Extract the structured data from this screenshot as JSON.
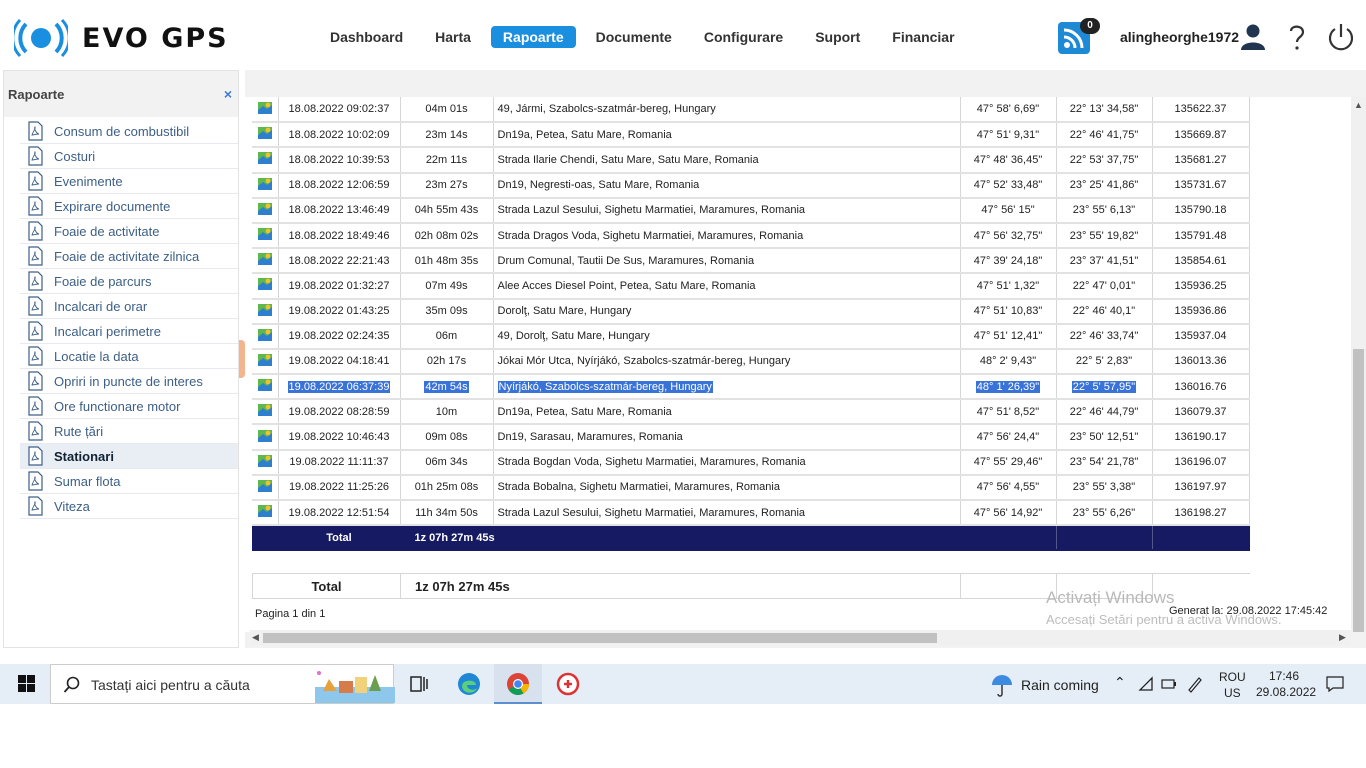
{
  "header": {
    "logo_text": "EVO GPS",
    "nav": [
      {
        "label": "Dashboard",
        "active": false
      },
      {
        "label": "Harta",
        "active": false
      },
      {
        "label": "Rapoarte",
        "active": true
      },
      {
        "label": "Documente",
        "active": false
      },
      {
        "label": "Configurare",
        "active": false
      },
      {
        "label": "Suport",
        "active": false
      },
      {
        "label": "Financiar",
        "active": false
      }
    ],
    "notification_count": "0",
    "username": "alingheorghe1972",
    "accent_color": "#1b8fdf"
  },
  "sidebar": {
    "title": "Rapoarte",
    "close_label": "×",
    "items": [
      {
        "label": "Consum de combustibil"
      },
      {
        "label": "Costuri"
      },
      {
        "label": "Evenimente"
      },
      {
        "label": "Expirare documente"
      },
      {
        "label": "Foaie de activitate"
      },
      {
        "label": "Foaie de activitate zilnica"
      },
      {
        "label": "Foaie de parcurs"
      },
      {
        "label": "Incalcari de orar"
      },
      {
        "label": "Incalcari perimetre"
      },
      {
        "label": "Locatie la data"
      },
      {
        "label": "Opriri in puncte de interes"
      },
      {
        "label": "Ore functionare motor"
      },
      {
        "label": "Rute țări"
      },
      {
        "label": "Stationari",
        "active": true
      },
      {
        "label": "Sumar flota"
      },
      {
        "label": "Viteza"
      }
    ]
  },
  "report": {
    "rows": [
      {
        "date": "18.08.2022 09:02:37",
        "duration": "04m 01s",
        "address": "49,   Jármi, Szabolcs-szatmár-bereg, Hungary",
        "lat": "47° 58' 6,69\"",
        "lon": "22° 13' 34,58\"",
        "km": "135622.37"
      },
      {
        "date": "18.08.2022 10:02:09",
        "duration": "23m 14s",
        "address": "Dn19a,   Petea, Satu Mare, Romania",
        "lat": "47° 51' 9,31\"",
        "lon": "22° 46' 41,75\"",
        "km": "135669.87"
      },
      {
        "date": "18.08.2022 10:39:53",
        "duration": "22m 11s",
        "address": "Strada Ilarie Chendi,   Satu Mare, Satu Mare, Romania",
        "lat": "47° 48' 36,45\"",
        "lon": "22° 53' 37,75\"",
        "km": "135681.27"
      },
      {
        "date": "18.08.2022 12:06:59",
        "duration": "23m 27s",
        "address": "Dn19,   Negresti-oas, Satu Mare, Romania",
        "lat": "47° 52' 33,48\"",
        "lon": "23° 25' 41,86\"",
        "km": "135731.67"
      },
      {
        "date": "18.08.2022 13:46:49",
        "duration": "04h 55m 43s",
        "address": "Strada Lazul Sesului,   Sighetu Marmatiei, Maramures, Romania",
        "lat": "47° 56' 15\"",
        "lon": "23° 55' 6,13\"",
        "km": "135790.18"
      },
      {
        "date": "18.08.2022 18:49:46",
        "duration": "02h 08m 02s",
        "address": "Strada Dragos Voda,   Sighetu Marmatiei, Maramures, Romania",
        "lat": "47° 56' 32,75\"",
        "lon": "23° 55' 19,82\"",
        "km": "135791.48"
      },
      {
        "date": "18.08.2022 22:21:43",
        "duration": "01h 48m 35s",
        "address": "Drum Comunal,   Tautii De Sus, Maramures, Romania",
        "lat": "47° 39' 24,18\"",
        "lon": "23° 37' 41,51\"",
        "km": "135854.61"
      },
      {
        "date": "19.08.2022 01:32:27",
        "duration": "07m 49s",
        "address": "Alee Acces Diesel Point,   Petea, Satu Mare, Romania",
        "lat": "47° 51' 1,32\"",
        "lon": "22° 47' 0,01\"",
        "km": "135936.25"
      },
      {
        "date": "19.08.2022 01:43:25",
        "duration": "35m 09s",
        "address": "Dorolţ, Satu Mare, Hungary",
        "lat": "47° 51' 10,83\"",
        "lon": "22° 46' 40,1\"",
        "km": "135936.86"
      },
      {
        "date": "19.08.2022 02:24:35",
        "duration": "06m",
        "address": "49,   Dorolţ, Satu Mare, Hungary",
        "lat": "47° 51' 12,41\"",
        "lon": "22° 46' 33,74\"",
        "km": "135937.04"
      },
      {
        "date": "19.08.2022 04:18:41",
        "duration": "02h 17s",
        "address": "Jókai Mór Utca,   Nyírjákó, Szabolcs-szatmár-bereg, Hungary",
        "lat": "48° 2' 9,43\"",
        "lon": "22° 5' 2,83\"",
        "km": "136013.36"
      },
      {
        "date": "19.08.2022 06:37:39",
        "duration": "42m 54s",
        "address": "Nyírjákó, Szabolcs-szatmár-bereg, Hungary",
        "lat": "48° 1' 26,39\"",
        "lon": "22° 5' 57,95\"",
        "km": "136016.76",
        "selected": true
      },
      {
        "date": "19.08.2022 08:28:59",
        "duration": "10m",
        "address": "Dn19a,   Petea, Satu Mare, Romania",
        "lat": "47° 51' 8,52\"",
        "lon": "22° 46' 44,79\"",
        "km": "136079.37"
      },
      {
        "date": "19.08.2022 10:46:43",
        "duration": "09m 08s",
        "address": "Dn19,   Sarasau, Maramures, Romania",
        "lat": "47° 56' 24,4\"",
        "lon": "23° 50' 12,51\"",
        "km": "136190.17"
      },
      {
        "date": "19.08.2022 11:11:37",
        "duration": "06m 34s",
        "address": "Strada Bogdan Voda,   Sighetu Marmatiei, Maramures, Romania",
        "lat": "47° 55' 29,46\"",
        "lon": "23° 54' 21,78\"",
        "km": "136196.07"
      },
      {
        "date": "19.08.2022 11:25:26",
        "duration": "01h 25m 08s",
        "address": "Strada Bobalna,   Sighetu Marmatiei, Maramures, Romania",
        "lat": "47° 56' 4,55\"",
        "lon": "23° 55' 3,38\"",
        "km": "136197.97"
      },
      {
        "date": "19.08.2022 12:51:54",
        "duration": "11h 34m 50s",
        "address": "Strada Lazul Sesului,   Sighetu Marmatiei, Maramures, Romania",
        "lat": "47° 56' 14,92\"",
        "lon": "23° 55' 6,26\"",
        "km": "136198.27"
      }
    ],
    "total_label": "Total",
    "total_value": "1z 07h 27m 45s",
    "grand_total_label": "Total",
    "grand_total_value": "1z 07h 27m 45s",
    "pagination": "Pagina 1 din 1",
    "generated": "Generat la: 29.08.2022 17:45:42",
    "header_color": "#151a63",
    "selection_color": "#3a73d8"
  },
  "watermark": {
    "line1": "Activați Windows",
    "line2": "Accesați Setări pentru a activa Windows."
  },
  "taskbar": {
    "search_placeholder": "Tastați aici pentru a căuta",
    "weather": "Rain coming",
    "lang_top": "ROU",
    "lang_bottom": "US",
    "time": "17:46",
    "date": "29.08.2022"
  }
}
